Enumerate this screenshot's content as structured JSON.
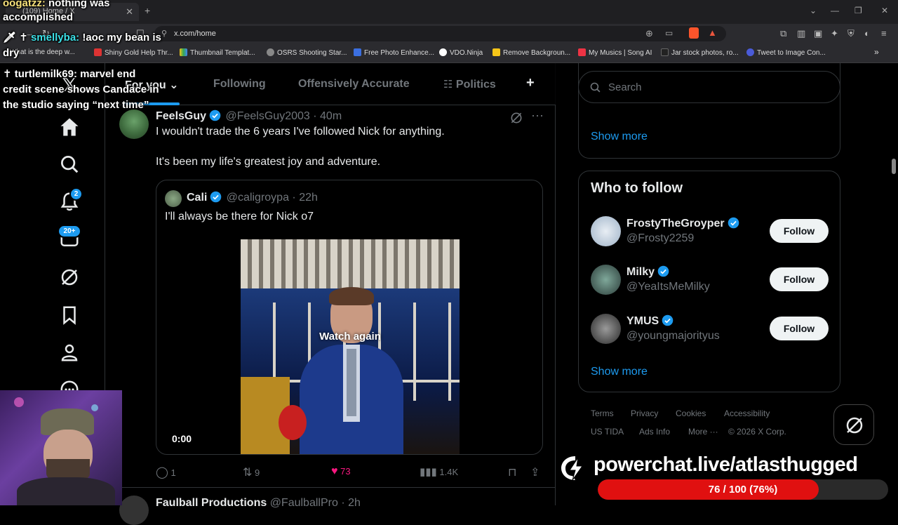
{
  "browser": {
    "tab_title": "(109) Home / X",
    "url": "x.com/home",
    "bookmarks": [
      "What is the deep w...",
      "Shiny Gold Help Thr...",
      "Thumbnail Templat...",
      "OSRS Shooting Star...",
      "Free Photo Enhance...",
      "VDO.Ninja",
      "Remove Backgroun...",
      "My Musics | Song AI",
      "Jar stock photos, ro...",
      "Tweet to Image Con..."
    ]
  },
  "nav": {
    "notifications_badge": "2",
    "messages_badge": "20+"
  },
  "tabs": [
    "For you",
    "Following",
    "Offensively Accurate",
    "Politics"
  ],
  "post": {
    "name": "FeelsGuy",
    "handle": "@FeelsGuy2003",
    "time": "· 40m",
    "text_line1": "I wouldn't trade the 6 years I've followed Nick for anything.",
    "text_line2": "It's been my life's greatest joy and adventure.",
    "quote": {
      "name": "Cali",
      "handle": "@caligroypa",
      "time": "· 22h",
      "text": "I'll always be there for Nick o7",
      "video_overlay": "Watch again",
      "video_time": "0:00"
    },
    "actions": {
      "replies": "1",
      "reposts": "9",
      "likes": "73",
      "views": "1.4K"
    }
  },
  "next_post_partial": {
    "name": "Faulball Productions",
    "handle": "@FaulballPro",
    "time": "· 2h"
  },
  "sidebar": {
    "search_placeholder": "Search",
    "show_more_top": "Show more",
    "who_to_follow_title": "Who to follow",
    "suggestions": [
      {
        "name": "FrostyTheGroyper",
        "handle": "@Frosty2259",
        "button": "Follow"
      },
      {
        "name": "Milky",
        "handle": "@YeaItsMeMilky",
        "button": "Follow"
      },
      {
        "name": "YMUS",
        "handle": "@youngmajorityus",
        "button": "Follow"
      }
    ],
    "show_more_bottom": "Show more",
    "footer": [
      "Terms",
      "Privacy",
      "Cookies",
      "Accessibility",
      "US TIDA",
      "Ads Info",
      "More ···",
      "© 2026 X Corp."
    ]
  },
  "overlay": {
    "chat": [
      {
        "user": "oogatzz:",
        "message": " nothing was"
      },
      {
        "user": "",
        "message": "accomplished"
      },
      {
        "user": "smellyba:",
        "message": " !aoc my bean is"
      },
      {
        "user": "",
        "message": "dry"
      },
      {
        "user": "turtlemilk69:",
        "message": " marvel end"
      },
      {
        "user": "",
        "message": "credit scene shows Candace in"
      },
      {
        "user": "",
        "message": "the studio saying “next time”"
      }
    ],
    "powerchat_url": "powerchat.live/atlasthugged",
    "powerchat_progress_text": "76 / 100 (76%)",
    "powerchat_progress": 0.76,
    "colors": {
      "accent": "#1d9bf0",
      "like": "#f91880",
      "progress": "#e01010"
    }
  }
}
